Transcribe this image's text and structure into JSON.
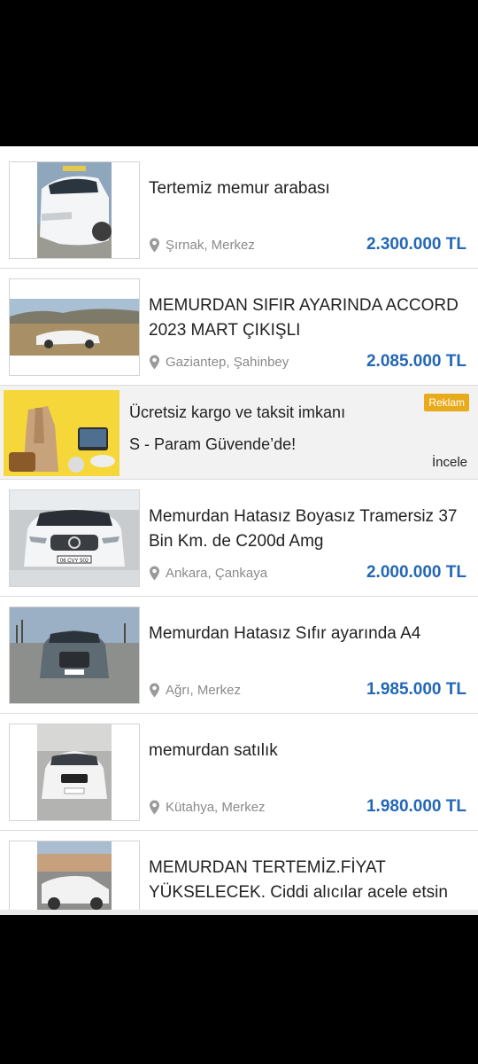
{
  "listings": [
    {
      "title": "Tertemiz memur arabası",
      "location": "Şırnak, Merkez",
      "price": "2.300.000 TL"
    },
    {
      "title": "MEMURDAN SIFIR AYARINDA ACCORD 2023 MART ÇIKIŞLI",
      "location": "Gaziantep, Şahinbey",
      "price": "2.085.000 TL"
    },
    {
      "title": "Memurdan Hatasız Boyasız Tramersiz 37 Bin Km. de C200d Amg",
      "location": "Ankara, Çankaya",
      "price": "2.000.000 TL",
      "plate": "06 CVY 502"
    },
    {
      "title": "Memurdan Hatasız Sıfır ayarında A4",
      "location": "Ağrı, Merkez",
      "price": "1.985.000 TL"
    },
    {
      "title": "memurdan satılık",
      "location": "Kütahya, Merkez",
      "price": "1.980.000 TL"
    },
    {
      "title": "MEMURDAN TERTEMİZ.FİYAT YÜKSELECEK. Ciddi alıcılar acele etsin"
    }
  ],
  "ad": {
    "line1": "Ücretsiz kargo ve taksit imkanı",
    "line2": "S - Param Güvende’de!",
    "badge": "Reklam",
    "link": "İncele"
  },
  "colors": {
    "price": "#2367b5",
    "badge": "#e8ab1c",
    "ad_image_bg": "#f6d73a"
  }
}
